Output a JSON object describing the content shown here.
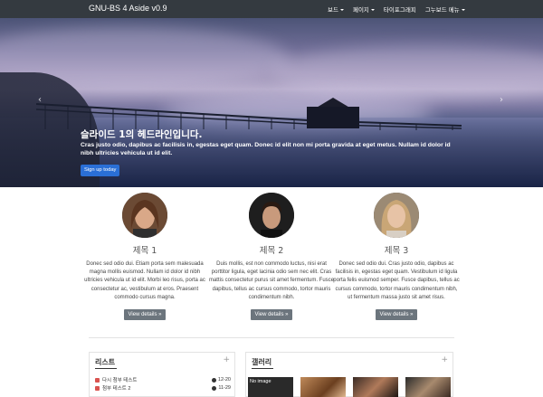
{
  "navbar": {
    "brand": "GNU-BS 4 Aside v0.9",
    "items": [
      {
        "label": "보드",
        "dropdown": true
      },
      {
        "label": "페이지",
        "dropdown": true
      },
      {
        "label": "타이포그래피",
        "dropdown": false
      },
      {
        "label": "그누보드 메뉴",
        "dropdown": true
      }
    ]
  },
  "carousel": {
    "title": "슬라이드 1의 헤드라인입니다.",
    "text": "Cras justo odio, dapibus ac facilisis in, egestas eget quam. Donec id elit non mi porta gravida at eget metus. Nullam id dolor id nibh ultricies vehicula ut id elit.",
    "button": "Sign up today",
    "prev_icon": "chevron-left-icon",
    "next_icon": "chevron-right-icon",
    "slide_count": 3,
    "active_slide": 1
  },
  "marketing": [
    {
      "title": "제목 1",
      "text": "Donec sed odio dui. Etiam porta sem malesuada magna mollis euismod. Nullam id dolor id nibh ultricies vehicula ut id elit. Morbi leo risus, porta ac consectetur ac, vestibulum at eros. Praesent commodo cursus magna.",
      "button": "View details »"
    },
    {
      "title": "제목 2",
      "text": "Duis mollis, est non commodo luctus, nisi erat porttitor ligula, eget lacinia odio sem nec elit. Cras mattis consectetur purus sit amet fermentum. Fusce dapibus, tellus ac cursus commodo, tortor mauris condimentum nibh.",
      "button": "View details »"
    },
    {
      "title": "제목 3",
      "text": "Donec sed odio dui. Cras justo odio, dapibus ac facilisis in, egestas eget quam. Vestibulum id ligula porta felis euismod semper. Fusce dapibus, tellus ac cursus commodo, tortor mauris condimentum nibh, ut fermentum massa justo sit amet risus.",
      "button": "View details »"
    }
  ],
  "list_panel": {
    "title": "리스트",
    "plus": "+",
    "items": [
      {
        "title": "다시 첨부 테스트",
        "date": "12-20"
      },
      {
        "title": "첨부 테스트 2",
        "date": "11-29"
      }
    ]
  },
  "gallery_panel": {
    "title": "갤러리",
    "plus": "+",
    "no_image_label": "No image"
  }
}
